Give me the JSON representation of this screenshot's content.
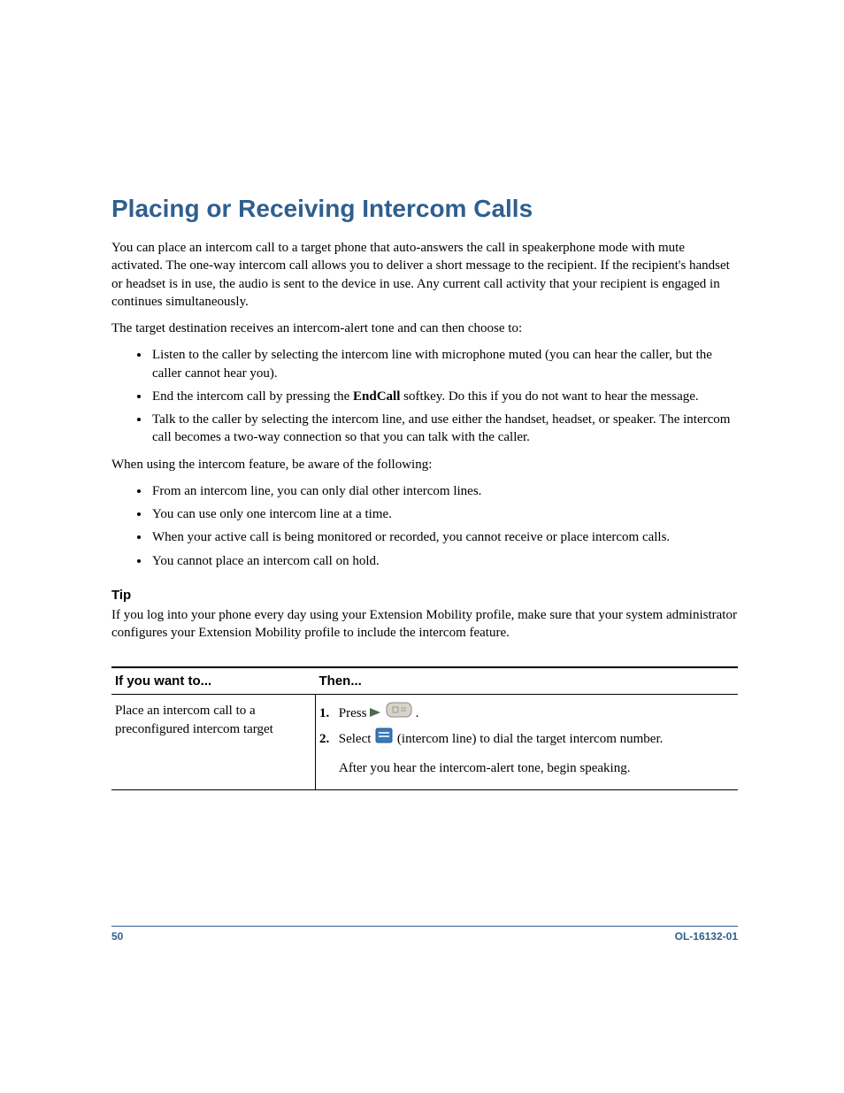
{
  "heading": "Placing or Receiving Intercom Calls",
  "intro": "You can place an intercom call to a target phone that auto-answers the call in speakerphone mode with mute activated. The one-way intercom call allows you to deliver a short message to the recipient. If the recipient's handset or headset is in use, the audio is sent to the device in use. Any current call activity that your recipient is engaged in continues simultaneously.",
  "dest_intro": "The target destination receives an intercom-alert tone and can then choose to:",
  "dest_bullets": [
    "Listen to the caller by selecting the intercom line with microphone muted (you can hear the caller, but the caller cannot hear you).",
    "Talk to the caller by selecting the intercom line, and use either the handset, headset, or speaker. The intercom call becomes a two-way connection so that you can talk with the caller."
  ],
  "endcall_bullet": {
    "pre": "End the intercom call by pressing the ",
    "bold": "EndCall",
    "post": " softkey. Do this if you do not want to hear the message."
  },
  "aware_intro": "When using the intercom feature, be aware of the following:",
  "aware_bullets": [
    "From an intercom line, you can only dial other intercom lines.",
    "You can use only one intercom line at a time.",
    "When your active call is being monitored or recorded, you cannot receive or place intercom calls.",
    "You cannot place an intercom call on hold."
  ],
  "tip_heading": "Tip",
  "tip_body": "If you log into your phone every day using your Extension Mobility profile, make sure that your system administrator configures your Extension Mobility profile to include the intercom feature.",
  "table": {
    "h1": "If you want to...",
    "h2": "Then...",
    "row1_left": "Place an intercom call to a preconfigured intercom target",
    "step1_num": "1.",
    "step1_pre": "Press ",
    "step1_post": " .",
    "step2_num": "2.",
    "step2_pre": "Select ",
    "step2_post": " (intercom line) to dial the target intercom number.",
    "step_after": "After you hear the intercom-alert tone, begin speaking."
  },
  "footer": {
    "page": "50",
    "docid": "OL-16132-01"
  }
}
